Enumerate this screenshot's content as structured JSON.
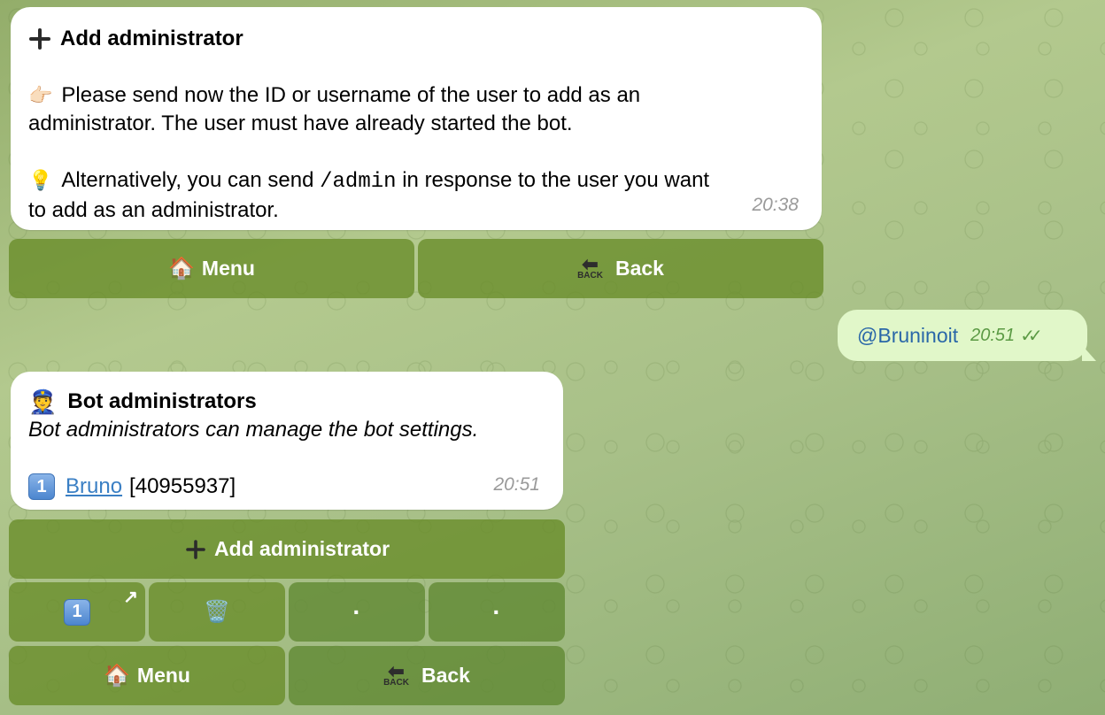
{
  "message1": {
    "title": "Add administrator",
    "line1_emoji": "👉🏻",
    "line1a": "Please send now the ID or username of the user to add as an",
    "line1b": "administrator. The user must have already started the bot.",
    "line2_emoji": "💡",
    "line2_pre": "Alternatively, you can send ",
    "line2_code": "/admin",
    "line2_post": " in response to the user you want",
    "line2b": "to add as an administrator.",
    "time": "20:38"
  },
  "keyboard1": {
    "menu_emoji": "🏠",
    "menu_label": "Menu",
    "back_icon_text": "BACK",
    "back_label": "Back"
  },
  "outgoing": {
    "username": "@Bruninoit",
    "time": "20:51",
    "checks": "✓✓"
  },
  "message2": {
    "title_emoji": "👮",
    "title": "Bot administrators",
    "subtitle": "Bot administrators can manage the bot settings.",
    "item_number": "1",
    "item_name": "Bruno",
    "item_id": "[40955937]",
    "time": "20:51"
  },
  "keyboard2": {
    "add_label": "Add administrator",
    "number_key": "1",
    "corner_arrow": "↗",
    "trash_emoji": "🗑️",
    "dot1": "·",
    "dot2": "·",
    "menu_emoji": "🏠",
    "menu_label": "Menu",
    "back_icon_text": "BACK",
    "back_label": "Back"
  },
  "colors": {
    "bubble_in": "#ffffff",
    "bubble_out": "#e1f7c9",
    "keyboard_button": "#6f8f35",
    "link": "#3a7fc4"
  }
}
